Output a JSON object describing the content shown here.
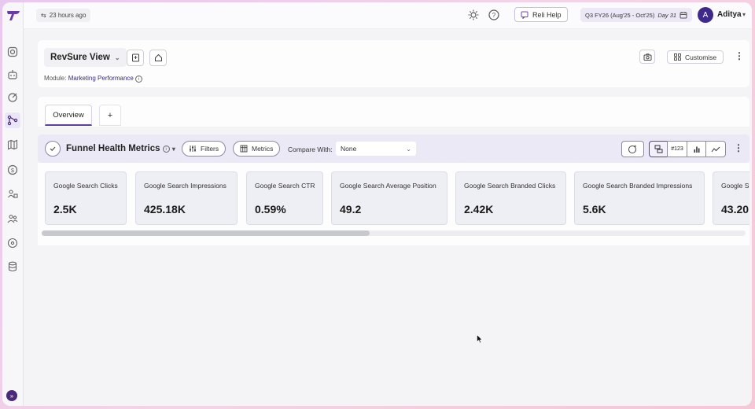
{
  "topbar": {
    "last_updated": "23 hours ago",
    "help_label": "Reli Help",
    "quarter_label": "Q3 FY26 (Aug'25 - Oct'25)",
    "quarter_day": "Day 31",
    "user": {
      "initial": "A",
      "name": "Aditya"
    }
  },
  "view": {
    "title": "RevSure View",
    "module_label": "Module:",
    "module_value": "Marketing Performance",
    "customise_label": "Customise"
  },
  "tabs": [
    {
      "label": "Overview",
      "active": true
    }
  ],
  "tab_add_label": "+",
  "metrics": {
    "title": "Funnel Health Metrics",
    "filters_label": "Filters",
    "metrics_label": "Metrics",
    "compare_label": "Compare With:",
    "compare_value": "None",
    "number_format_label": "#123",
    "cards": [
      {
        "label": "Google Search Clicks",
        "value": "2.5K"
      },
      {
        "label": "Google Search Impressions",
        "value": "425.18K"
      },
      {
        "label": "Google Search CTR",
        "value": "0.59%"
      },
      {
        "label": "Google Search Average Position",
        "value": "49.2"
      },
      {
        "label": "Google Search Branded Clicks",
        "value": "2.42K"
      },
      {
        "label": "Google Search Branded Impressions",
        "value": "5.6K"
      },
      {
        "label": "Google S",
        "value": "43.20"
      }
    ],
    "scroll_position": 0.47
  },
  "colors": {
    "accent": "#5b3fa6",
    "avatar": "#3f2a8c",
    "header_bg": "#ece9f6"
  },
  "icons": {
    "sidebar": [
      "instagram-icon",
      "bot-icon",
      "target-icon",
      "flow-icon",
      "map-icon",
      "dollar-icon",
      "users-grid-icon",
      "people-icon",
      "puzzle-icon",
      "database-icon"
    ],
    "topbar": [
      "sun-icon",
      "help-icon",
      "chat-icon",
      "calendar-icon"
    ]
  }
}
